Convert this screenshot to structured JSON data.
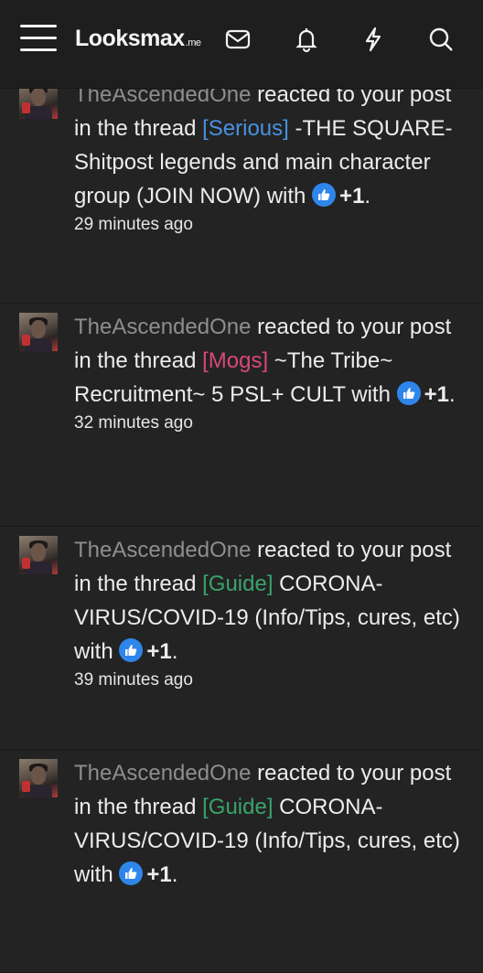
{
  "header": {
    "logo_main": "Looksmax",
    "logo_tld": ".me",
    "icons": [
      "menu-icon",
      "envelope-icon",
      "bell-icon",
      "lightning-icon",
      "search-icon"
    ]
  },
  "colors": {
    "background": "#232323",
    "header": "#1e1e1e",
    "username": "#8e8e8e",
    "prefix_serious": "#4a90e2",
    "prefix_mogs": "#d9477a",
    "prefix_guide": "#3aa36b",
    "like_badge": "#2f86ea"
  },
  "notifications": [
    {
      "user": "TheAscendedOne",
      "action": " reacted to your post in the thread ",
      "prefix": "[Serious]",
      "title": " -THE SQUARE- Shitpost legends and main character group (JOIN NOW) with ",
      "reaction": "+1",
      "end": ".",
      "time": "29 minutes ago"
    },
    {
      "user": "TheAscendedOne",
      "action": " reacted to your post in the thread ",
      "prefix": "[Mogs]",
      "title": " ~The Tribe~ Recruitment~ 5 PSL+ CULT with ",
      "reaction": "+1",
      "end": ".",
      "time": "32 minutes ago"
    },
    {
      "user": "TheAscendedOne",
      "action": " reacted to your post in the thread ",
      "prefix": "[Guide]",
      "title": " CORONA-VIRUS/COVID-19 (Info/Tips, cures, etc) with ",
      "reaction": "+1",
      "end": ".",
      "time": "39 minutes ago"
    },
    {
      "user": "TheAscendedOne",
      "action": " reacted to your post in the thread ",
      "prefix": "[Guide]",
      "title": " CORONA-VIRUS/COVID-19 (Info/Tips, cures, etc) with ",
      "reaction": "+1",
      "end": ".",
      "time": ""
    }
  ]
}
